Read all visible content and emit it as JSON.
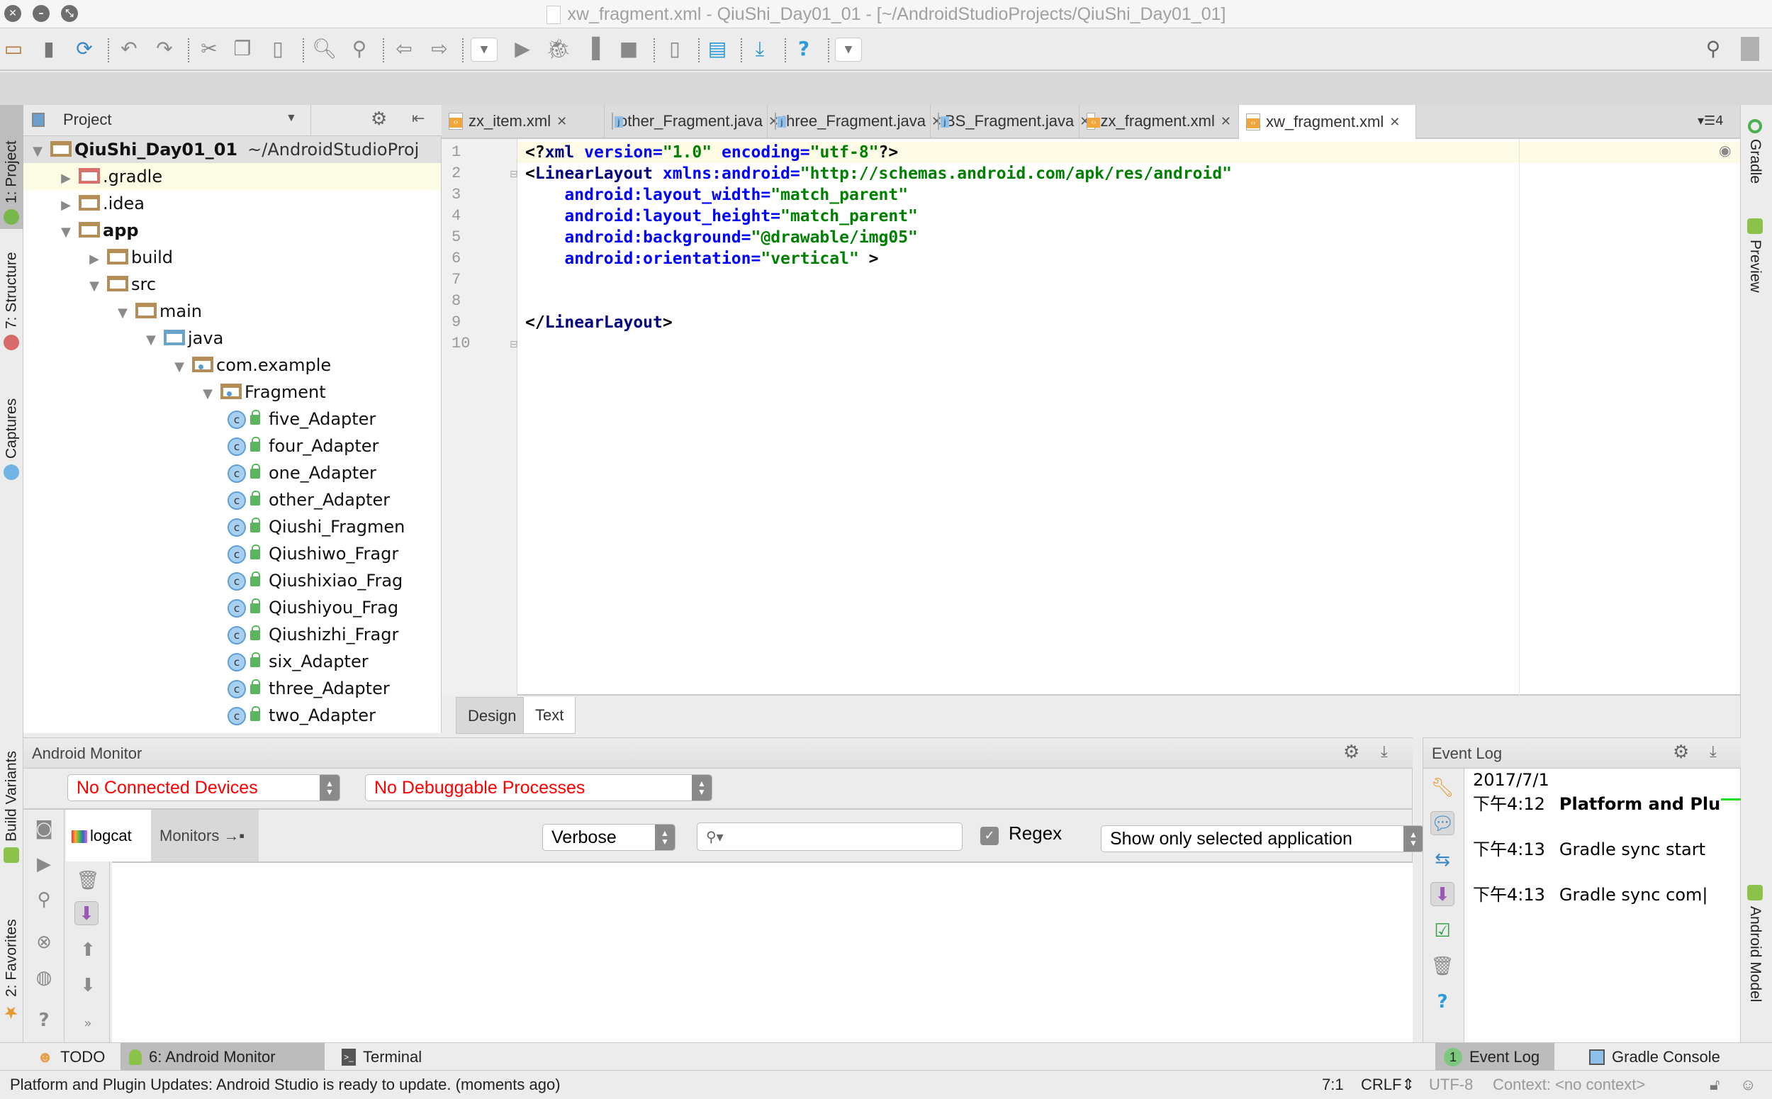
{
  "window": {
    "title": "xw_fragment.xml - QiuShi_Day01_01 - [~/AndroidStudioProjects/QiuShi_Day01_01]",
    "controls": [
      "close",
      "minimize",
      "fullscreen"
    ]
  },
  "toolbar": {
    "icons": [
      "open-folder",
      "save-all",
      "synchronize",
      "undo",
      "redo",
      "cut",
      "copy",
      "paste",
      "find",
      "replace",
      "back",
      "forward",
      "run-config-dropdown",
      "run",
      "debug",
      "profile",
      "stop",
      "avd-manager",
      "project-structure",
      "sdk-manager",
      "help",
      "more-dropdown",
      "search",
      "user"
    ]
  },
  "left_strip": {
    "tabs": [
      {
        "label": "1: Project",
        "icon": "android-studio-icon",
        "active": true
      },
      {
        "label": "7: Structure",
        "icon": "structure-icon",
        "active": false
      },
      {
        "label": "Captures",
        "icon": "captures-icon",
        "active": false
      },
      {
        "label": "Build Variants",
        "icon": "android-icon",
        "active": false
      },
      {
        "label": "2: Favorites",
        "icon": "star-icon",
        "active": false
      }
    ]
  },
  "right_strip": {
    "tabs": [
      {
        "label": "Gradle",
        "icon": "gradle-icon"
      },
      {
        "label": "Preview",
        "icon": "preview-icon"
      },
      {
        "label": "Android Model",
        "icon": "android-icon"
      }
    ]
  },
  "project_panel": {
    "title": "Project",
    "tree": [
      {
        "label": "QiuShi_Day01_01",
        "suffix": "~/AndroidStudioProj",
        "level": 0,
        "expanded": true,
        "type": "project",
        "bold": true
      },
      {
        "label": ".gradle",
        "level": 1,
        "expanded": false,
        "type": "folder-red"
      },
      {
        "label": ".idea",
        "level": 1,
        "expanded": false,
        "type": "folder"
      },
      {
        "label": "app",
        "level": 1,
        "expanded": true,
        "type": "module",
        "bold": true
      },
      {
        "label": "build",
        "level": 2,
        "expanded": false,
        "type": "folder"
      },
      {
        "label": "src",
        "level": 2,
        "expanded": true,
        "type": "folder"
      },
      {
        "label": "main",
        "level": 3,
        "expanded": true,
        "type": "folder"
      },
      {
        "label": "java",
        "level": 4,
        "expanded": true,
        "type": "folder-blue"
      },
      {
        "label": "com.example",
        "level": 5,
        "expanded": true,
        "type": "package"
      },
      {
        "label": "Fragment",
        "level": 6,
        "expanded": true,
        "type": "package"
      },
      {
        "label": "five_Adapter",
        "level": 7,
        "type": "class"
      },
      {
        "label": "four_Adapter",
        "level": 7,
        "type": "class"
      },
      {
        "label": "one_Adapter",
        "level": 7,
        "type": "class"
      },
      {
        "label": "other_Adapter",
        "level": 7,
        "type": "class"
      },
      {
        "label": "Qiushi_Fragmen",
        "level": 7,
        "type": "class"
      },
      {
        "label": "Qiushiwo_Fragr",
        "level": 7,
        "type": "class"
      },
      {
        "label": "Qiushixiao_Frag",
        "level": 7,
        "type": "class"
      },
      {
        "label": "Qiushiyou_Frag",
        "level": 7,
        "type": "class"
      },
      {
        "label": "Qiushizhi_Fragr",
        "level": 7,
        "type": "class"
      },
      {
        "label": "six_Adapter",
        "level": 7,
        "type": "class"
      },
      {
        "label": "three_Adapter",
        "level": 7,
        "type": "class"
      },
      {
        "label": "two_Adapter",
        "level": 7,
        "type": "class"
      }
    ]
  },
  "editor_tabs": [
    {
      "label": "zx_item.xml",
      "type": "xml",
      "active": false
    },
    {
      "label": "other_Fragment.java",
      "type": "java",
      "active": false
    },
    {
      "label": "three_Fragment.java",
      "type": "java",
      "active": false
    },
    {
      "label": "BS_Fragment.java",
      "type": "java",
      "active": false
    },
    {
      "label": "zx_fragment.xml",
      "type": "xml",
      "active": false
    },
    {
      "label": "xw_fragment.xml",
      "type": "xml",
      "active": true
    }
  ],
  "editor_tabs_overflow": "4",
  "editor": {
    "lines": [
      [
        {
          "t": "<?",
          "c": "pi"
        },
        {
          "t": "xml ",
          "c": "tag"
        },
        {
          "t": "version=",
          "c": "attr"
        },
        {
          "t": "\"1.0\"",
          "c": "val"
        },
        {
          "t": " encoding=",
          "c": "attr"
        },
        {
          "t": "\"utf-8\"",
          "c": "val"
        },
        {
          "t": "?>",
          "c": "pi"
        }
      ],
      [
        {
          "t": "<",
          "c": "pi"
        },
        {
          "t": "LinearLayout ",
          "c": "tag"
        },
        {
          "t": "xmlns:android=",
          "c": "attr"
        },
        {
          "t": "\"http://schemas.android.com/apk/res/android\"",
          "c": "val"
        }
      ],
      [
        {
          "t": "    android:layout_width=",
          "c": "attr"
        },
        {
          "t": "\"match_parent\"",
          "c": "val"
        }
      ],
      [
        {
          "t": "    android:layout_height=",
          "c": "attr"
        },
        {
          "t": "\"match_parent\"",
          "c": "val"
        }
      ],
      [
        {
          "t": "    android:background=",
          "c": "attr"
        },
        {
          "t": "\"@drawable/img05\"",
          "c": "val"
        }
      ],
      [
        {
          "t": "    android:orientation=",
          "c": "attr"
        },
        {
          "t": "\"vertical\"",
          "c": "val"
        },
        {
          "t": " >",
          "c": "pi"
        }
      ],
      [],
      [],
      [
        {
          "t": "</",
          "c": "pi"
        },
        {
          "t": "LinearLayout",
          "c": "tag"
        },
        {
          "t": ">",
          "c": "pi"
        }
      ],
      []
    ],
    "line_numbers": [
      "1",
      "2",
      "3",
      "4",
      "5",
      "6",
      "7",
      "8",
      "9",
      "10"
    ]
  },
  "design_tabs": [
    {
      "label": "Design",
      "active": false
    },
    {
      "label": "Text",
      "active": true
    }
  ],
  "android_monitor": {
    "title": "Android Monitor",
    "device_select": "No Connected Devices",
    "process_select": "No Debuggable Processes",
    "subtabs": [
      {
        "label": "logcat",
        "active": true
      },
      {
        "label": "Monitors",
        "active": false
      }
    ],
    "log_level": "Verbose",
    "search_value": "",
    "regex_label": "Regex",
    "regex_checked": true,
    "filter_select": "Show only selected application"
  },
  "event_log": {
    "title": "Event Log",
    "date": "2017/7/1",
    "entries": [
      {
        "time": "下午4:12",
        "message": "Platform and Plu",
        "bold": true
      },
      {
        "time": "下午4:13",
        "message": "Gradle sync start",
        "bold": false
      },
      {
        "time": "下午4:13",
        "message": "Gradle sync com|",
        "bold": false
      }
    ]
  },
  "bottom_tabs": {
    "left": [
      {
        "label": "TODO",
        "icon": "todo-icon",
        "active": false
      },
      {
        "label": "6: Android Monitor",
        "icon": "android-icon",
        "active": true
      },
      {
        "label": "Terminal",
        "icon": "terminal-icon",
        "active": false
      }
    ],
    "right": [
      {
        "label": "Event Log",
        "badge": "1",
        "active": true
      },
      {
        "label": "Gradle Console",
        "icon": "console-icon",
        "active": false
      }
    ]
  },
  "status_bar": {
    "message": "Platform and Plugin Updates: Android Studio is ready to update. (moments ago)",
    "position": "7:1",
    "line_separator": "CRLF",
    "encoding": "UTF-8",
    "context": "Context: <no context>"
  },
  "colors": {
    "xml_tag": "#000080",
    "xml_attr": "#0000ff",
    "xml_value": "#008000",
    "error_text": "#ff0000",
    "caret_row": "#fdfbe6"
  }
}
